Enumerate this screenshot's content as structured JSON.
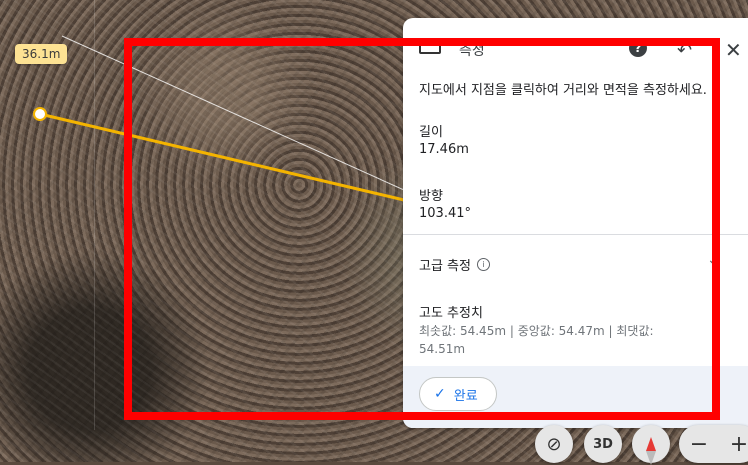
{
  "map": {
    "distance_label": "36.1m"
  },
  "panel": {
    "title": "측정",
    "help_icon": "?",
    "undo_icon": "↶",
    "close_icon": "✕",
    "instruction": "지도에서 지점을 클릭하여 거리와 면적을 측정하세요.",
    "length_label": "길이",
    "length_value": "17.46m",
    "heading_label": "방향",
    "heading_value": "103.41°",
    "advanced_label": "고급 측정",
    "info_icon": "i",
    "chevron_icon": "⌄",
    "elevation_title": "고도 추정치",
    "elevation_values": "최솟값: 54.45m | 중앙값: 54.47m | 최댓값: 54.51m",
    "done_label": "완료",
    "done_icon": "✓"
  },
  "controls": {
    "ortho_icon": "⊘",
    "three_d_label": "3D",
    "zoom_out": "−",
    "zoom_in": "+"
  },
  "colors": {
    "measure_line": "#f4b400",
    "highlight": "#ff0000",
    "accent": "#1a73e8"
  }
}
